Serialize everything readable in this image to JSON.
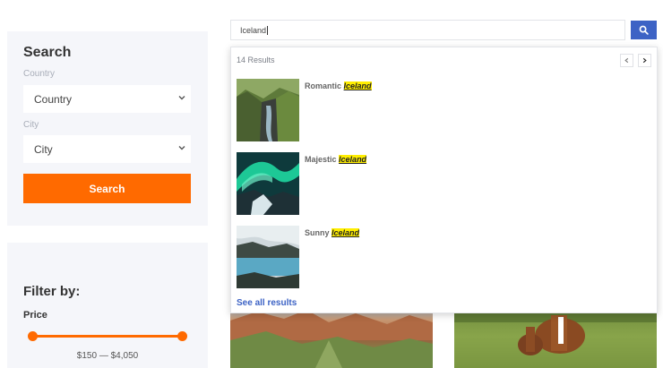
{
  "sidebar": {
    "search_title": "Search",
    "country_label": "Country",
    "country_value": "Country",
    "city_label": "City",
    "city_value": "City",
    "search_button": "Search",
    "filter_title": "Filter by:",
    "price_label": "Price",
    "price_range": "$150 — $4,050"
  },
  "search_bar": {
    "query": "Iceland"
  },
  "dropdown": {
    "results_count": "14 Results",
    "results": [
      {
        "prefix": "Romantic",
        "highlight": "Iceland",
        "thumb": "waterfall-canyon-photo"
      },
      {
        "prefix": "Majestic",
        "highlight": "Iceland",
        "thumb": "aurora-photo"
      },
      {
        "prefix": "Sunny",
        "highlight": "Iceland",
        "thumb": "lagoon-photo"
      }
    ],
    "see_all": "See all results"
  },
  "colors": {
    "accent_orange": "#ff6a00",
    "accent_blue": "#3d63c5",
    "highlight_yellow": "#ffee00",
    "panel_bg": "#f5f6fa"
  },
  "icons": {
    "search_button_icon": "search-icon",
    "select_icon": "chevron-down-icon",
    "pager_prev_icon": "chevron-left-icon",
    "pager_next_icon": "chevron-right-icon"
  }
}
